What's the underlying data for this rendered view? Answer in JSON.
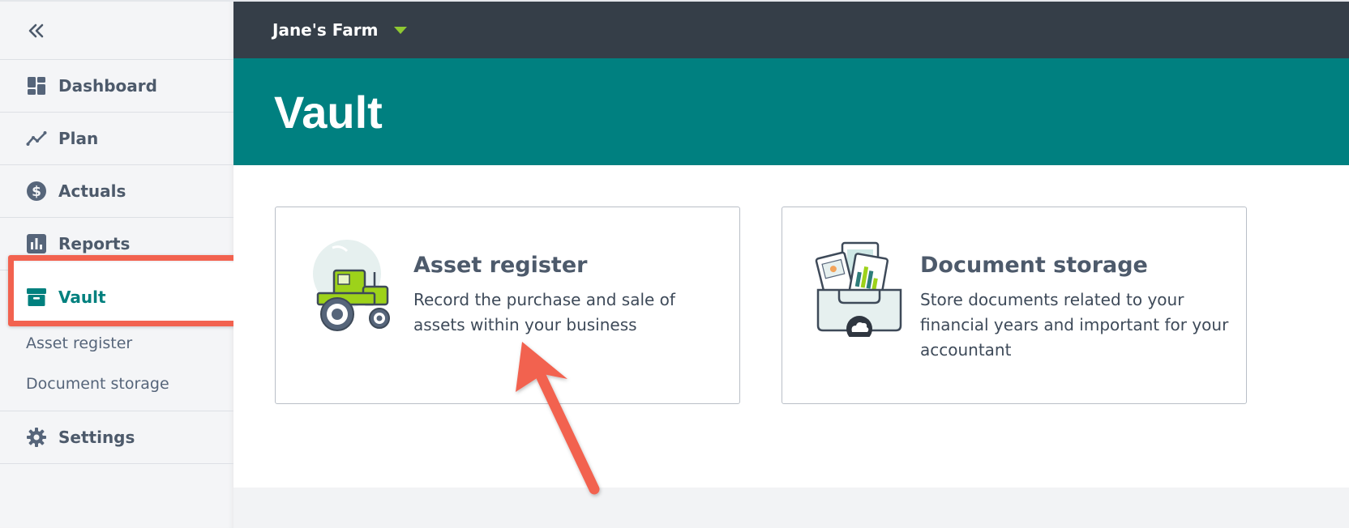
{
  "topbar": {
    "farm_name": "Jane's Farm"
  },
  "sidebar": {
    "items": [
      {
        "label": "Dashboard",
        "icon": "dashboard-icon"
      },
      {
        "label": "Plan",
        "icon": "plan-icon"
      },
      {
        "label": "Actuals",
        "icon": "dollar-icon"
      },
      {
        "label": "Reports",
        "icon": "reports-icon"
      },
      {
        "label": "Vault",
        "icon": "vault-icon"
      },
      {
        "label": "Settings",
        "icon": "gear-icon"
      }
    ],
    "vault_sub": [
      {
        "label": "Asset register"
      },
      {
        "label": "Document storage"
      }
    ]
  },
  "header": {
    "title": "Vault"
  },
  "cards": [
    {
      "title": "Asset register",
      "description": "Record the purchase and sale of assets within your business",
      "icon": "tractor-icon"
    },
    {
      "title": "Document storage",
      "description": "Store documents related to your financial years and important for your accountant",
      "icon": "document-folder-icon"
    }
  ],
  "colors": {
    "accent": "#008080",
    "topbar": "#353e48",
    "annotation": "#f2624f",
    "caret": "#8fc832"
  }
}
